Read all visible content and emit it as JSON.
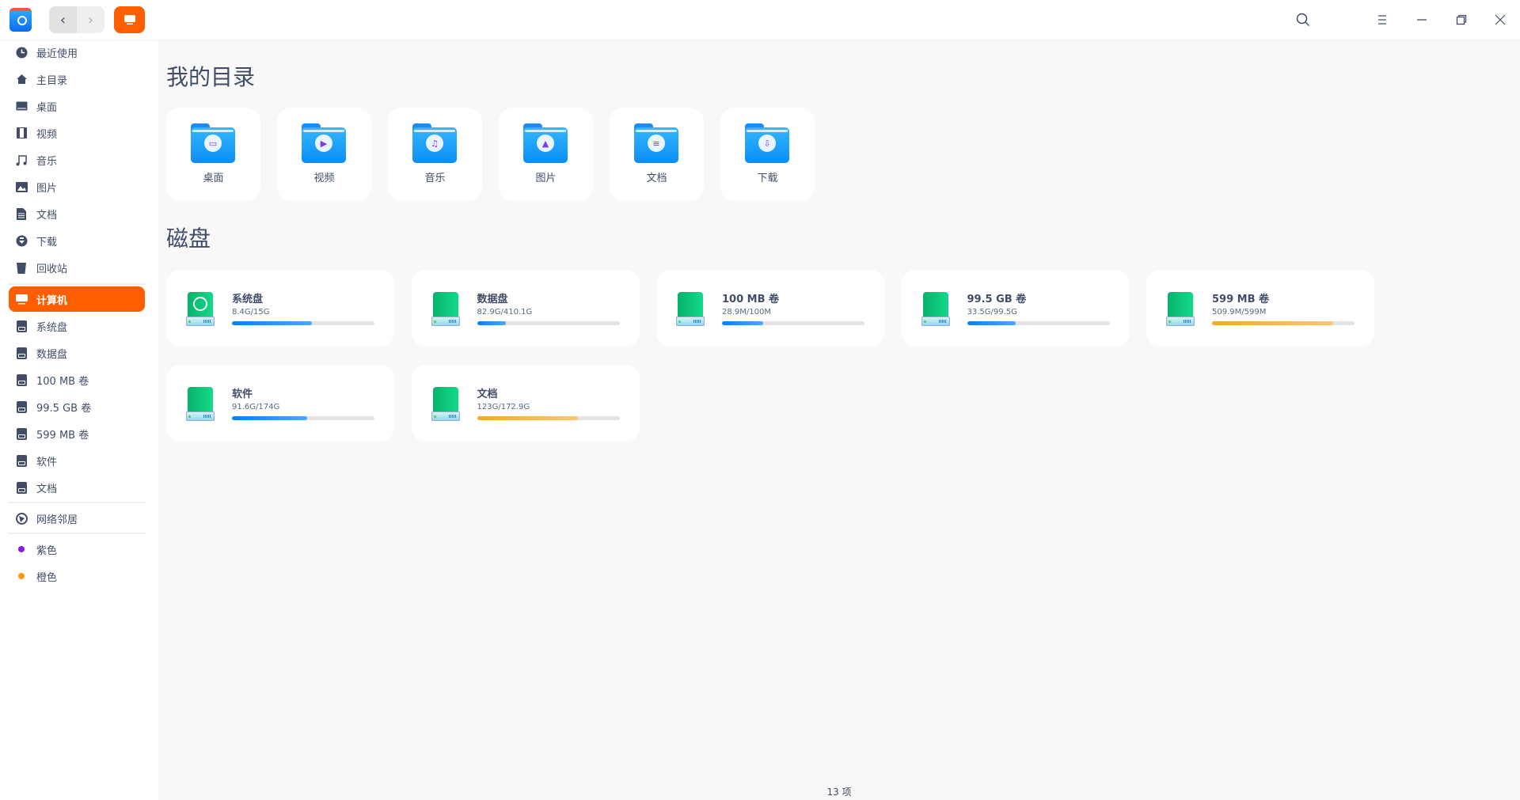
{
  "titlebar": {
    "back": "‹",
    "forward": "›",
    "icons": [
      "search-icon",
      "menu-icon",
      "minimize-icon",
      "maximize-icon",
      "close-icon"
    ]
  },
  "sidebar": {
    "items": [
      {
        "label": "最近使用",
        "icon": "clock-icon"
      },
      {
        "label": "主目录",
        "icon": "home-icon"
      },
      {
        "label": "桌面",
        "icon": "desktop-icon"
      },
      {
        "label": "视频",
        "icon": "film-icon"
      },
      {
        "label": "音乐",
        "icon": "music-icon"
      },
      {
        "label": "图片",
        "icon": "picture-icon"
      },
      {
        "label": "文档",
        "icon": "document-icon"
      },
      {
        "label": "下载",
        "icon": "download-icon"
      },
      {
        "label": "回收站",
        "icon": "trash-icon"
      }
    ],
    "computer": "计算机",
    "disks": [
      "系统盘",
      "数据盘",
      "100 MB 卷",
      "99.5 GB 卷",
      "599 MB 卷",
      "软件",
      "文档"
    ],
    "network": "网络邻居",
    "tags": [
      {
        "label": "紫色",
        "color": "#8a17f5"
      },
      {
        "label": "橙色",
        "color": "#ff9b0a"
      }
    ]
  },
  "main": {
    "dirs_title": "我的目录",
    "folders": [
      "桌面",
      "视频",
      "音乐",
      "图片",
      "文档",
      "下载"
    ],
    "disks_title": "磁盘",
    "disks": [
      {
        "name": "系统盘",
        "size": "8.4G/15G",
        "used": 0.56,
        "color": "blue"
      },
      {
        "name": "数据盘",
        "size": "82.9G/410.1G",
        "used": 0.2,
        "color": "blue"
      },
      {
        "name": "100 MB 卷",
        "size": "28.9M/100M",
        "used": 0.29,
        "color": "blue"
      },
      {
        "name": "99.5 GB 卷",
        "size": "33.5G/99.5G",
        "used": 0.34,
        "color": "blue"
      },
      {
        "name": "599 MB 卷",
        "size": "509.9M/599M",
        "used": 0.85,
        "color": "orange"
      },
      {
        "name": "软件",
        "size": "91.6G/174G",
        "used": 0.53,
        "color": "blue"
      },
      {
        "name": "文档",
        "size": "123G/172.9G",
        "used": 0.71,
        "color": "orange"
      }
    ]
  },
  "status": {
    "count": "13 项"
  }
}
